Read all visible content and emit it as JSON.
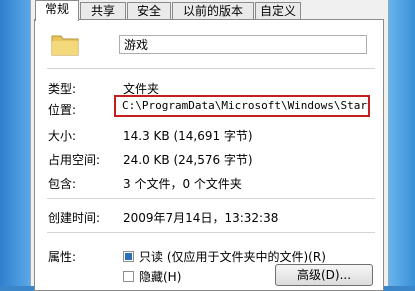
{
  "tabs": [
    "常规",
    "共享",
    "安全",
    "以前的版本",
    "自定义"
  ],
  "name_value": "游戏",
  "properties": {
    "type_label": "类型:",
    "type_value": "文件夹",
    "location_label": "位置:",
    "location_value": "C:\\ProgramData\\Microsoft\\Windows\\Start Me",
    "size_label": "大小:",
    "size_value": "14.3 KB (14,691 字节)",
    "disk_label": "占用空间:",
    "disk_value": "24.0 KB (24,576 字节)",
    "contains_label": "包含:",
    "contains_value": "3 个文件，0 个文件夹",
    "created_label": "创建时间:",
    "created_value": "2009年7月14日，13:32:38"
  },
  "attributes": {
    "label": "属性:",
    "readonly_label": "只读 (仅应用于文件夹中的文件)(R)",
    "readonly_checked": true,
    "hidden_label": "隐藏(H)",
    "hidden_checked": false,
    "advanced_button": "高级(D)..."
  },
  "colors": {
    "highlight_border": "#c41e1e",
    "accent": "#2f6fb6"
  }
}
